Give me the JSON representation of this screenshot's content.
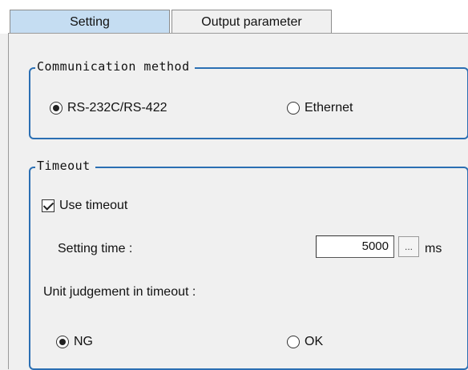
{
  "tabs": [
    {
      "label": "Setting",
      "active": true
    },
    {
      "label": "Output parameter",
      "active": false
    }
  ],
  "communication": {
    "legend": "Communication method",
    "options": [
      {
        "label": "RS-232C/RS-422",
        "selected": true
      },
      {
        "label": "Ethernet",
        "selected": false
      }
    ]
  },
  "timeout": {
    "legend": "Timeout",
    "use_timeout_label": "Use timeout",
    "use_timeout_checked": true,
    "setting_time_label": "Setting time :",
    "setting_time_value": "5000",
    "ellipsis_label": "...",
    "unit": "ms",
    "judgement_label": "Unit judgement in timeout :",
    "judgement_options": [
      {
        "label": "NG",
        "selected": true
      },
      {
        "label": "OK",
        "selected": false
      }
    ]
  },
  "colors": {
    "active_tab": "#c5ddf2",
    "group_border": "#2b6fb3"
  }
}
